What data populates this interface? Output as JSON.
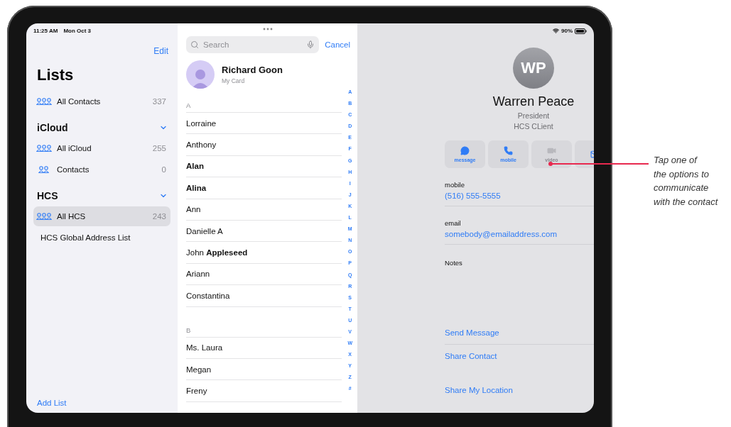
{
  "status_bar": {
    "time": "11:25 AM",
    "date": "Mon Oct 3",
    "battery": "90%"
  },
  "sidebar": {
    "edit": "Edit",
    "title": "Lists",
    "add_list": "Add List",
    "top_items": [
      {
        "label": "All Contacts",
        "count": "337",
        "kind": "group3",
        "selected": false
      }
    ],
    "groups": [
      {
        "name": "iCloud",
        "expanded": true,
        "items": [
          {
            "label": "All iCloud",
            "count": "255",
            "kind": "group3",
            "selected": false
          },
          {
            "label": "Contacts",
            "count": "0",
            "kind": "group2",
            "selected": false
          }
        ]
      },
      {
        "name": "HCS",
        "expanded": true,
        "items": [
          {
            "label": "All HCS",
            "count": "243",
            "kind": "group3",
            "selected": true
          },
          {
            "label": "HCS Global Address List",
            "kind": "plain",
            "selected": false
          }
        ]
      }
    ]
  },
  "contacts": {
    "search": {
      "placeholder": "Search"
    },
    "cancel": "Cancel",
    "my_card": {
      "name": "Richard Goon",
      "subtitle": "My Card"
    },
    "sections": [
      {
        "letter": "A",
        "rows": [
          {
            "name": "Lorraine",
            "bold": false
          },
          {
            "name": "Anthony",
            "bold": false
          },
          {
            "name": "Alan",
            "bold": true
          },
          {
            "name": "Alina",
            "bold": true
          },
          {
            "name": "Ann",
            "bold": false
          },
          {
            "name": "Danielle A",
            "bold": false
          },
          {
            "name": "John **Appleseed**",
            "bold": false
          },
          {
            "name": "Ariann",
            "bold": false
          },
          {
            "name": "Constantina",
            "bold": false
          }
        ]
      },
      {
        "letter": "B",
        "rows": [
          {
            "name": "Ms. Laura",
            "bold": false
          },
          {
            "name": "Megan",
            "bold": false
          },
          {
            "name": "Freny",
            "bold": false
          }
        ]
      }
    ],
    "index": [
      "A",
      "B",
      "C",
      "D",
      "E",
      "F",
      "G",
      "H",
      "I",
      "J",
      "K",
      "L",
      "M",
      "N",
      "O",
      "P",
      "Q",
      "R",
      "S",
      "T",
      "U",
      "V",
      "W",
      "X",
      "Y",
      "Z",
      "#"
    ]
  },
  "detail": {
    "initials": "WP",
    "name": "Warren Peace",
    "title": "President",
    "company": "HCS CLient",
    "actions": [
      {
        "kind": "message",
        "label": "message",
        "disabled": false
      },
      {
        "kind": "phone",
        "label": "mobile",
        "disabled": false
      },
      {
        "kind": "video",
        "label": "video",
        "disabled": true
      }
    ],
    "fields": [
      {
        "label": "mobile",
        "value": "(516) 555-5555"
      },
      {
        "label": "email",
        "value": "somebody@emailaddress.com"
      }
    ],
    "notes_label": "Notes",
    "links": [
      {
        "label": "Send Message",
        "divider": true
      },
      {
        "label": "Share Contact",
        "divider": false
      },
      {
        "label": "Share My Location",
        "divider": false
      }
    ]
  },
  "annotation": {
    "text": "Tap one of\nthe options to\ncommunicate\nwith the contact"
  }
}
